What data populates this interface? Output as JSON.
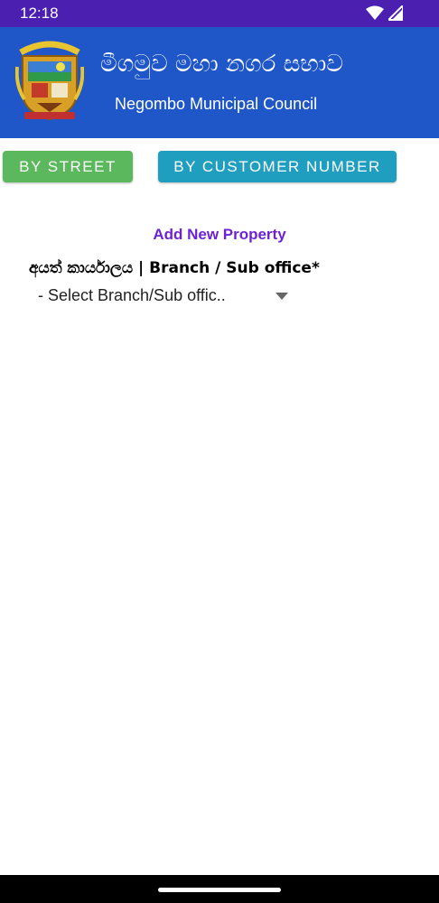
{
  "status_bar": {
    "time": "12:18",
    "icons": [
      "wifi-icon",
      "signal-icon"
    ]
  },
  "header": {
    "title_sinhala": "මීගමුව මහා නගර සභාව",
    "title_english": "Negombo Municipal Council",
    "logo": "negombo-municipal-council-crest"
  },
  "tabs": {
    "by_street": "BY STREET",
    "by_customer_number": "BY CUSTOMER NUMBER"
  },
  "main": {
    "add_new_property": "Add New Property",
    "branch_label": "අයත් කාර්යාලය | Branch / Sub office*",
    "branch_select_value": "- Select Branch/Sub offic.."
  },
  "colors": {
    "status_bar": "#4b1fb0",
    "header": "#1f56c8",
    "by_street_button": "#5cb85c",
    "by_customer_button": "#1f9ebf",
    "link": "#6e22d4"
  }
}
